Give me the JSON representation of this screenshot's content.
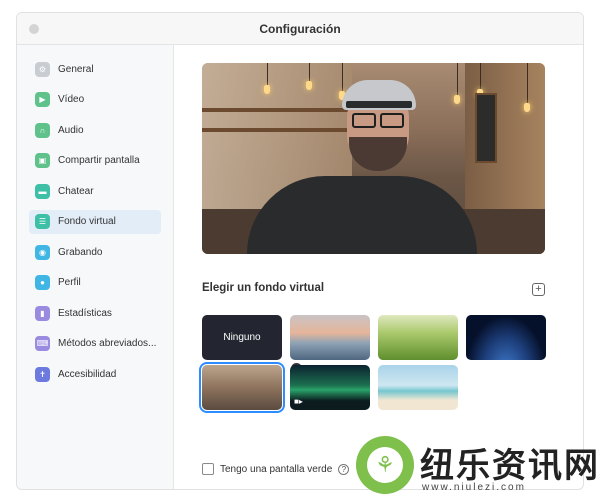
{
  "window": {
    "title": "Configuración"
  },
  "sidebar": {
    "items": [
      {
        "label": "General",
        "icon": "gear-icon",
        "color": "#c9cdd2"
      },
      {
        "label": "Vídeo",
        "icon": "video-camera-icon",
        "color": "#5fc28a"
      },
      {
        "label": "Audio",
        "icon": "headphones-icon",
        "color": "#5fc28a"
      },
      {
        "label": "Compartir pantalla",
        "icon": "share-screen-icon",
        "color": "#5fc28a"
      },
      {
        "label": "Chatear",
        "icon": "chat-bubble-icon",
        "color": "#3ec0a6"
      },
      {
        "label": "Fondo virtual",
        "icon": "virtual-background-icon",
        "color": "#3ec0a6",
        "active": true
      },
      {
        "label": "Grabando",
        "icon": "record-icon",
        "color": "#3fb6e3"
      },
      {
        "label": "Perfil",
        "icon": "profile-icon",
        "color": "#3fb6e3"
      },
      {
        "label": "Estadísticas",
        "icon": "statistics-icon",
        "color": "#9b8be0"
      },
      {
        "label": "Métodos abreviados...",
        "icon": "keyboard-icon",
        "color": "#9b8be0"
      },
      {
        "label": "Accesibilidad",
        "icon": "accessibility-icon",
        "color": "#6c7ae0"
      }
    ]
  },
  "main": {
    "section_title": "Elegir un fondo virtual",
    "add_symbol": "+",
    "backgrounds": [
      {
        "label": "Ninguno",
        "kind": "none"
      },
      {
        "kind": "bridge"
      },
      {
        "kind": "grass"
      },
      {
        "kind": "earth"
      },
      {
        "kind": "cafe",
        "selected": true
      },
      {
        "kind": "aurora",
        "video": true
      },
      {
        "kind": "beach"
      }
    ],
    "green_screen_label": "Tengo una pantalla verde",
    "help_symbol": "?"
  },
  "watermark": {
    "chinese": "纽乐资讯网",
    "url": "www.niulezi.com"
  },
  "colors": {
    "accent": "#2d8cff",
    "active_bg": "#e3edf8"
  }
}
